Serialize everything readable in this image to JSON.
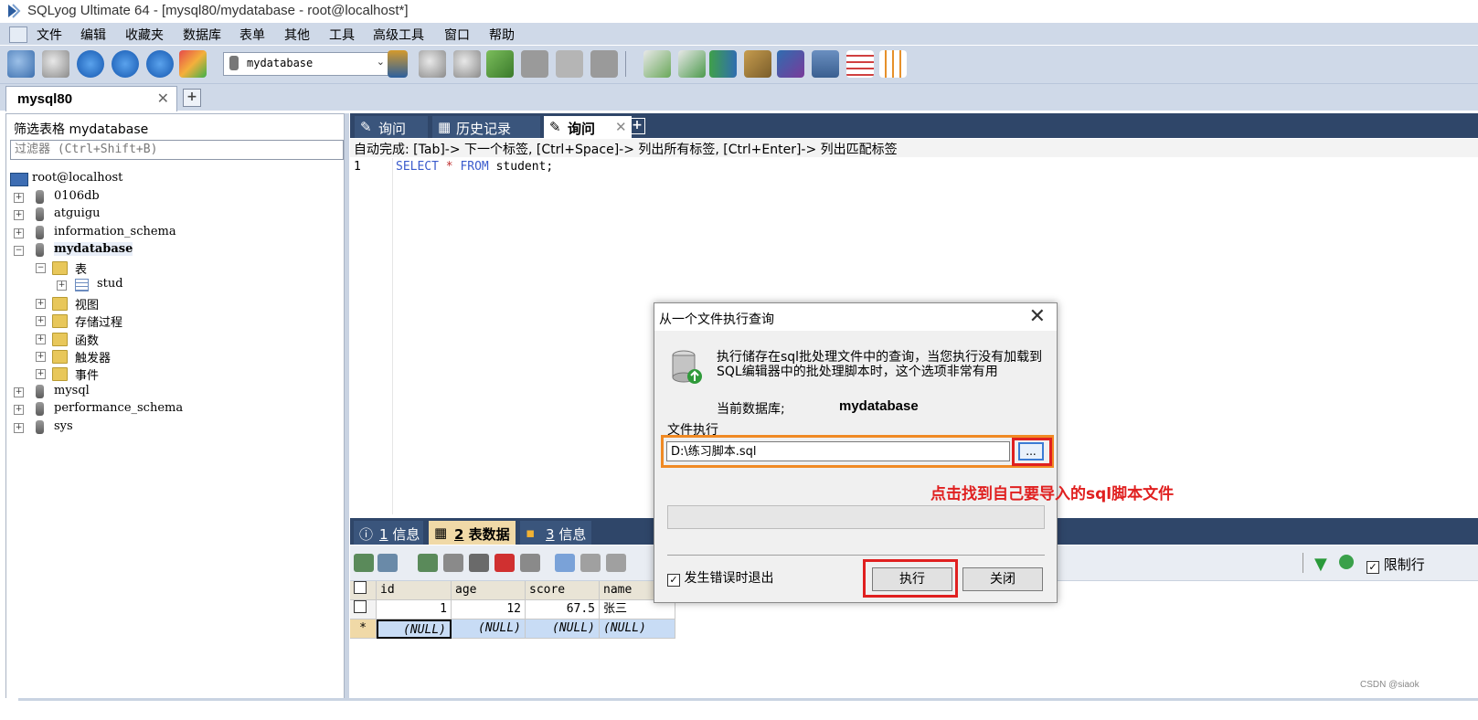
{
  "window": {
    "title": "SQLyog Ultimate 64 - [mysql80/mydatabase - root@localhost*]"
  },
  "menu": [
    "文件",
    "编辑",
    "收藏夹",
    "数据库",
    "表单",
    "其他",
    "工具",
    "高级工具",
    "窗口",
    "帮助"
  ],
  "toolbar": {
    "database_select": "mydatabase"
  },
  "connection_tab": {
    "label": "mysql80",
    "close": "✕",
    "add": "+"
  },
  "left_panel": {
    "title": "筛选表格 mydatabase",
    "filter_placeholder": "过滤器 (Ctrl+Shift+B)",
    "tree": {
      "root": "root@localhost",
      "databases": [
        "0106db",
        "atguigu",
        "information_schema",
        "mydatabase",
        "mysql",
        "performance_schema",
        "sys"
      ],
      "mydatabase_children": [
        "表",
        "视图",
        "存储过程",
        "函数",
        "触发器",
        "事件"
      ],
      "table_item": "stud"
    }
  },
  "query_tabs": [
    {
      "label": "询问"
    },
    {
      "label": "历史记录"
    },
    {
      "label": "询问",
      "close": "✕"
    }
  ],
  "query_tab_add": "+",
  "editor": {
    "autocomplete_hint": "自动完成: [Tab]-> 下一个标签, [Ctrl+Space]-> 列出所有标签, [Ctrl+Enter]-> 列出匹配标签",
    "line_number": "1",
    "code_keyword1": "SELECT",
    "code_star": "*",
    "code_keyword2": "FROM",
    "code_table": "student;"
  },
  "result_tabs": [
    {
      "num": "1",
      "label": "信息"
    },
    {
      "num": "2",
      "label": "表数据"
    },
    {
      "num": "3",
      "label": "信息"
    }
  ],
  "result_toolbar": {
    "limit_label": "限制行"
  },
  "grid": {
    "columns": [
      "id",
      "age",
      "score",
      "name"
    ],
    "rows": [
      {
        "id": "1",
        "age": "12",
        "score": "67.5",
        "name": "张三"
      },
      {
        "id": "(NULL)",
        "age": "(NULL)",
        "score": "(NULL)",
        "name": "(NULL)"
      }
    ],
    "new_row_marker": "*"
  },
  "dialog": {
    "title": "从一个文件执行查询",
    "close": "✕",
    "description": "执行储存在sql批处理文件中的查询，当您执行没有加载到SQL编辑器中的批处理脚本时，这个选项非常有用",
    "current_db_label": "当前数据库;",
    "current_db": "mydatabase",
    "file_label": "文件执行",
    "file_path": "D:\\练习脚本.sql",
    "browse": "...",
    "stop_on_error": "发生错误时退出",
    "execute": "执行",
    "close_button": "关闭"
  },
  "annotation": "点击找到自己要导入的sql脚本文件",
  "watermark": "CSDN @siaok"
}
